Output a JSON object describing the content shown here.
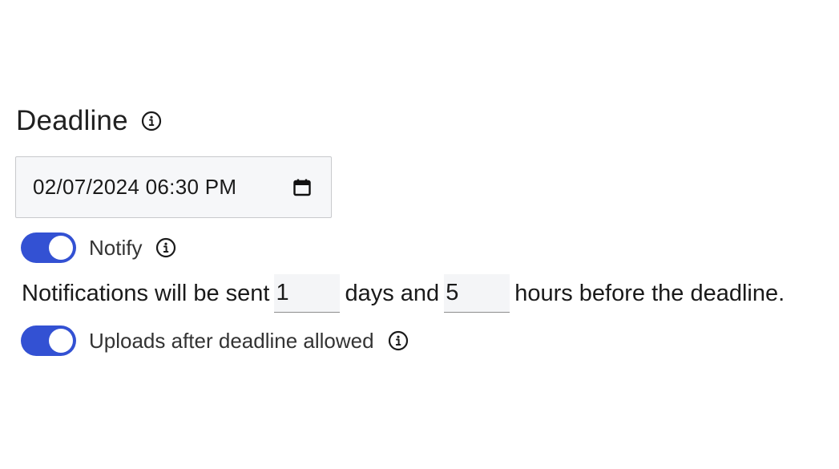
{
  "deadline": {
    "title": "Deadline",
    "info_icon": "info-icon",
    "datetime_value": "02/07/2024 06:30 PM",
    "calendar_icon": "calendar-icon"
  },
  "notify": {
    "label": "Notify",
    "enabled": true,
    "info_icon": "info-icon"
  },
  "notification_sentence": {
    "prefix": "Notifications will be sent",
    "days_value": "1",
    "middle": "days and",
    "hours_value": "5",
    "suffix": "hours before the deadline."
  },
  "uploads_after_deadline": {
    "label": "Uploads after deadline allowed",
    "enabled": true,
    "info_icon": "info-icon"
  },
  "colors": {
    "toggle_on": "#3351d3",
    "input_background": "#f6f7f9",
    "input_border": "#c8c9cc"
  }
}
